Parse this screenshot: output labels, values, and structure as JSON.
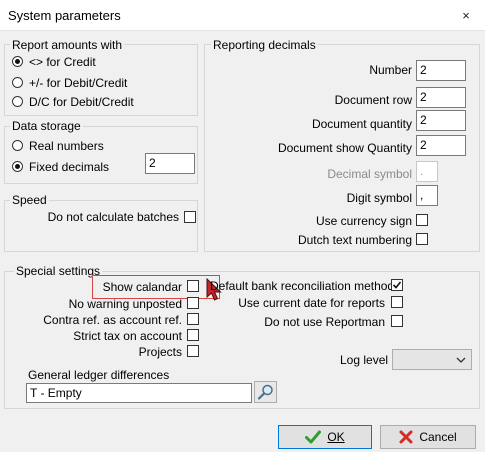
{
  "window": {
    "title": "System parameters",
    "close_glyph": "×"
  },
  "report_amounts": {
    "legend": "Report amounts with",
    "options": [
      {
        "label": "<>  for Credit",
        "checked": true
      },
      {
        "label": "+/-  for Debit/Credit",
        "checked": false
      },
      {
        "label": "D/C for Debit/Credit",
        "checked": false
      }
    ]
  },
  "data_storage": {
    "legend": "Data storage",
    "options": [
      {
        "label": "Real numbers",
        "checked": false
      },
      {
        "label": "Fixed decimals",
        "checked": true
      }
    ],
    "fixed_decimals_value": "2"
  },
  "speed": {
    "legend": "Speed",
    "no_calc_batches_label": "Do not calculate batches"
  },
  "reporting_decimals": {
    "legend": "Reporting decimals",
    "number": {
      "label": "Number",
      "value": "2"
    },
    "document_row": {
      "label": "Document row",
      "value": "2"
    },
    "document_quantity": {
      "label": "Document quantity",
      "value": "2"
    },
    "document_show_quantity": {
      "label": "Document show Quantity",
      "value": "2"
    },
    "decimal_symbol": {
      "label": "Decimal symbol",
      "value": "."
    },
    "digit_symbol": {
      "label": "Digit symbol",
      "value": ","
    },
    "use_currency_sign": {
      "label": "Use currency sign"
    },
    "dutch_text_numbering": {
      "label": "Dutch text numbering"
    }
  },
  "special_settings": {
    "legend": "Special settings",
    "left_checks": [
      {
        "label": "Show calandar",
        "checked": false
      },
      {
        "label": "No warning unposted",
        "checked": false
      },
      {
        "label": "Contra ref. as account ref.",
        "checked": false
      },
      {
        "label": "Strict tax on account",
        "checked": false
      },
      {
        "label": "Projects",
        "checked": false
      }
    ],
    "right_checks": [
      {
        "label": "Default bank reconciliation method",
        "checked": true
      },
      {
        "label": "Use current date for reports",
        "checked": false
      },
      {
        "label": "Do not use Reportman",
        "checked": false
      }
    ],
    "log_level_label": "Log level",
    "log_level_value": "",
    "gl_differences_label": "General ledger differences",
    "gl_differences_value": "T - Empty"
  },
  "buttons": {
    "ok_label": "OK",
    "cancel_label": "Cancel"
  },
  "colors": {
    "ok_check": "#2f9e2f",
    "cancel_x": "#d42a2a",
    "highlight": "#d64545",
    "cursor": "#c0262c"
  },
  "icons": {
    "close": "close-icon",
    "ok": "checkmark-icon",
    "cancel": "x-icon",
    "search": "magnifier-icon",
    "cursor": "mouse-pointer-icon"
  }
}
